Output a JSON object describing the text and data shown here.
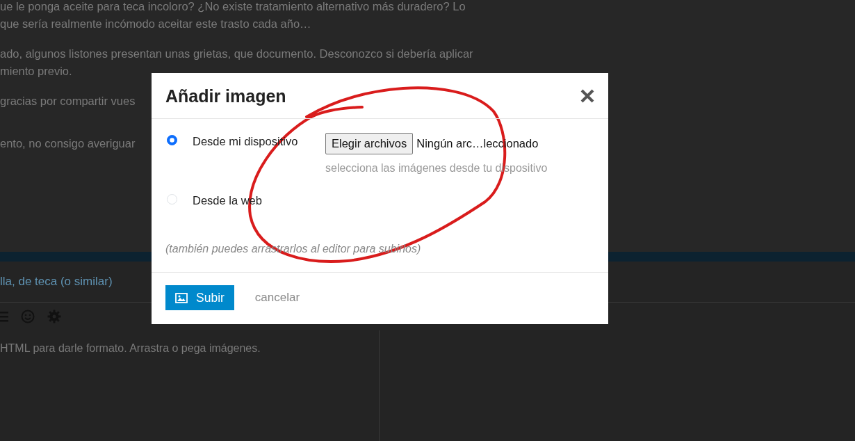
{
  "background": {
    "paragraphs": [
      [
        "ue le ponga aceite para teca incoloro? ¿No existe tratamiento alternativo más duradero? Lo",
        "que sería realmente incómodo aceitar este trasto cada año…"
      ],
      [
        "ado, algunos listones presentan unas grietas, que documento. Desconozco si debería aplicar",
        "miento previo."
      ],
      [
        "gracias por compartir vues"
      ],
      [
        "ento, no consigo averiguar"
      ]
    ],
    "title_field": "lla, de teca (o similar)",
    "editor_hint": "HTML para darle formato. Arrastra o pega imágenes."
  },
  "dialog": {
    "title": "Añadir imagen",
    "options": [
      {
        "label": "Desde mi dispositivo",
        "selected": true
      },
      {
        "label": "Desde la web",
        "selected": false
      }
    ],
    "file_button": "Elegir archivos",
    "file_status": "Ningún arc…leccionado",
    "file_hint": "selecciona las imágenes desde tu dispositivo",
    "drag_note": "(también puedes arrastrarlos al editor para subirlos)",
    "submit": "Subir",
    "cancel": "cancelar"
  }
}
